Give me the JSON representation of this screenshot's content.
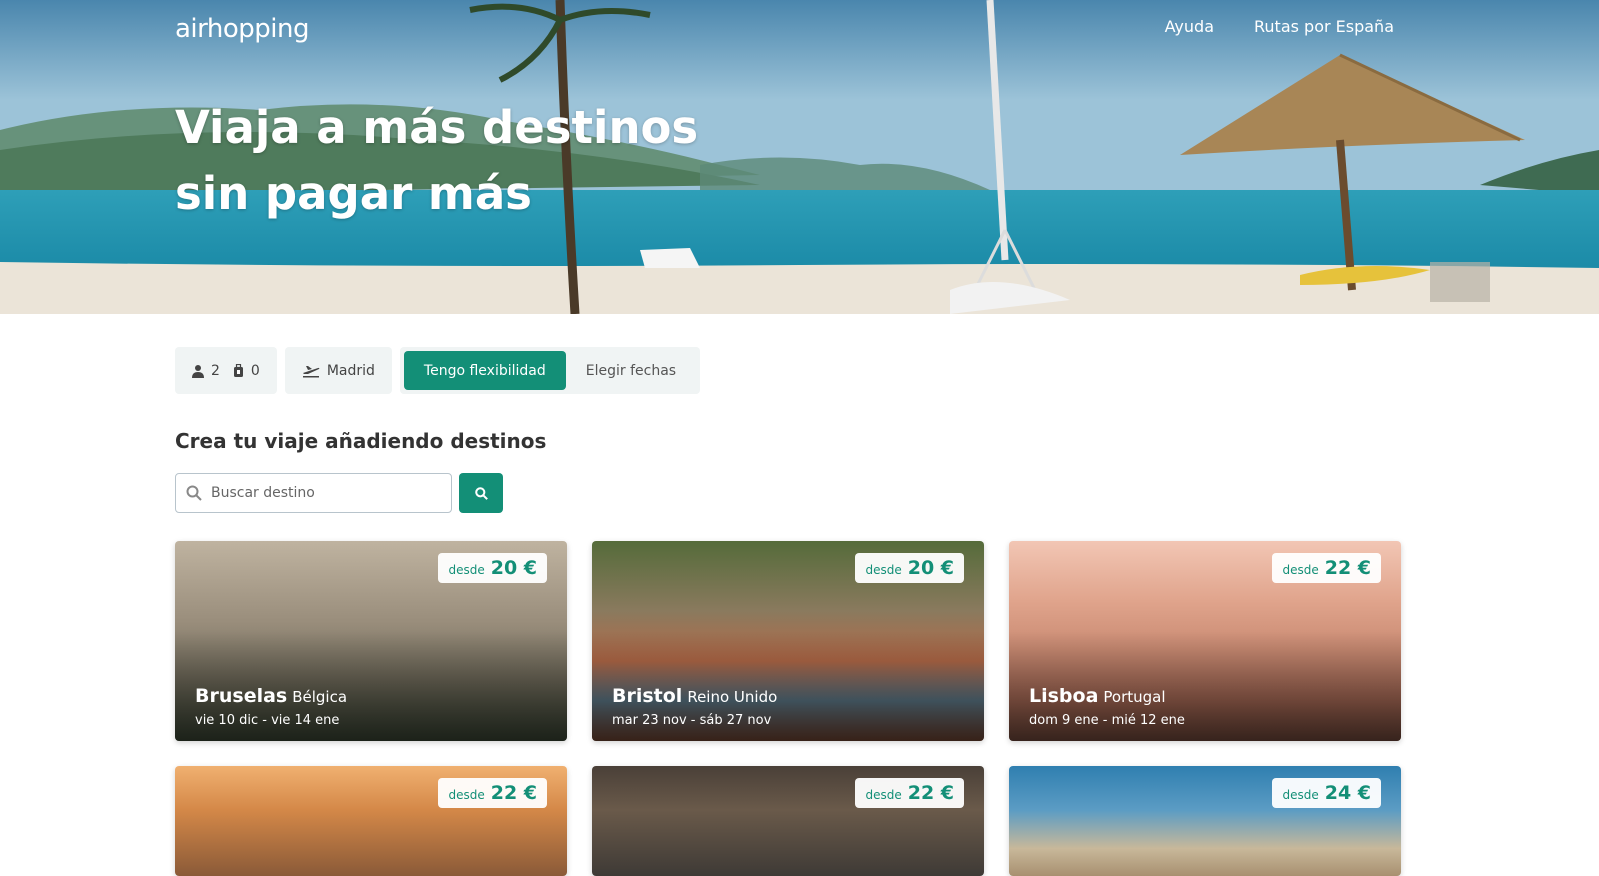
{
  "header": {
    "logo": "airhopping",
    "nav": [
      "Ayuda",
      "Rutas por España"
    ],
    "hero_title": "Viaja a más destinos sin pagar más"
  },
  "filters": {
    "adults": "2",
    "bags": "0",
    "origin": "Madrid",
    "flex_label": "Tengo flexibilidad",
    "dates_label": "Elegir fechas"
  },
  "section_title": "Crea tu viaje añadiendo destinos",
  "search": {
    "placeholder": "Buscar destino"
  },
  "colors": {
    "accent": "#138f77"
  },
  "destinations": [
    {
      "from": "desde",
      "price": "20 €",
      "city": "Bruselas",
      "country": "Bélgica",
      "dates": "vie 10 dic - vie 14 ene"
    },
    {
      "from": "desde",
      "price": "20 €",
      "city": "Bristol",
      "country": "Reino Unido",
      "dates": "mar 23 nov - sáb 27 nov"
    },
    {
      "from": "desde",
      "price": "22 €",
      "city": "Lisboa",
      "country": "Portugal",
      "dates": "dom 9 ene - mié 12 ene"
    },
    {
      "from": "desde",
      "price": "22 €"
    },
    {
      "from": "desde",
      "price": "22 €"
    },
    {
      "from": "desde",
      "price": "24 €"
    }
  ]
}
